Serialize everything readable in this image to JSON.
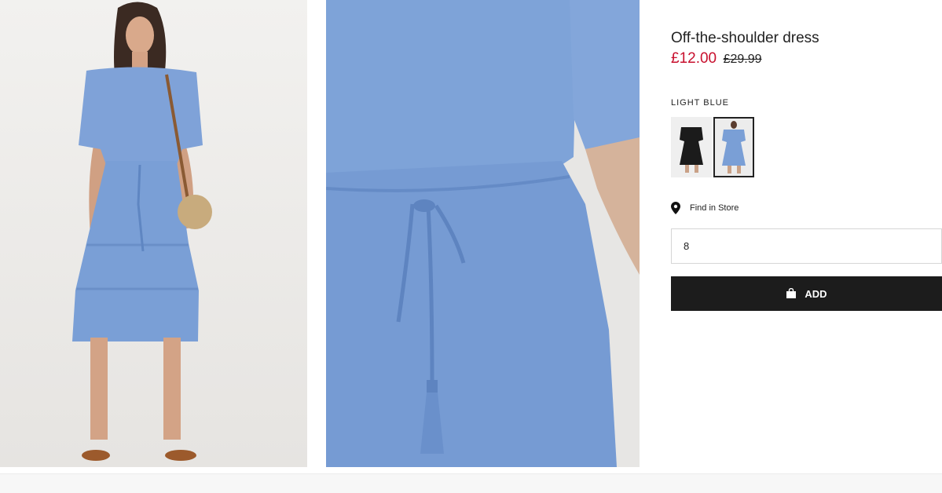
{
  "product": {
    "title": "Off-the-shoulder dress",
    "price_sale": "£12.00",
    "price_original": "£29.99",
    "color_label": "LIGHT BLUE",
    "swatches": [
      {
        "name": "black",
        "color": "#1b1b1b"
      },
      {
        "name": "light-blue",
        "color": "#7a9fd6",
        "selected": true
      }
    ]
  },
  "store": {
    "find_label": "Find in Store",
    "icon": "location-pin-icon"
  },
  "size_field": {
    "value": "8"
  },
  "add_button": {
    "label": "ADD",
    "icon": "shopping-bag-icon"
  },
  "colors": {
    "sale": "#c8102e",
    "button": "#1c1c1c",
    "dress": "#7a9fd6"
  }
}
